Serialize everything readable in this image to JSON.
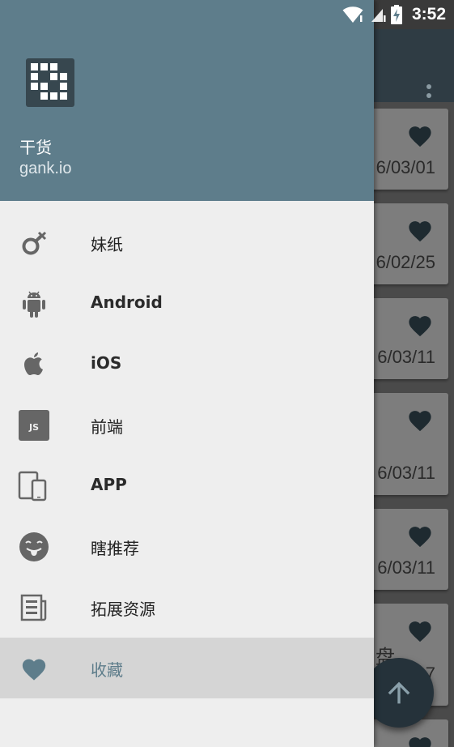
{
  "status_bar": {
    "time": "3:52"
  },
  "drawer": {
    "header": {
      "title": "干货",
      "subtitle": "gank.io"
    },
    "items": [
      {
        "label": "妹纸",
        "icon": "female-symbol-icon"
      },
      {
        "label": "Android",
        "icon": "android-icon"
      },
      {
        "label": "iOS",
        "icon": "apple-icon"
      },
      {
        "label": "前端",
        "icon": "javascript-icon",
        "icon_text": "JS"
      },
      {
        "label": "APP",
        "icon": "devices-icon"
      },
      {
        "label": "瞎推荐",
        "icon": "tongue-emoji-icon"
      },
      {
        "label": "拓展资源",
        "icon": "article-icon"
      },
      {
        "label": "收藏",
        "icon": "heart-icon",
        "selected": true
      }
    ]
  },
  "background_list": {
    "cards": [
      {
        "date": "6/03/01"
      },
      {
        "date": "6/02/25"
      },
      {
        "date": "6/03/11"
      },
      {
        "date": "6/03/11"
      },
      {
        "date": "6/03/11"
      },
      {
        "fragment": "盘",
        "date_fragment": "7"
      }
    ]
  },
  "colors": {
    "drawer_header": "#5e7d8b",
    "drawer_background": "#eeeeee",
    "selected_item_background": "#d5d5d5",
    "selected_item_text": "#5e7d8b",
    "fab": "#25323a"
  }
}
